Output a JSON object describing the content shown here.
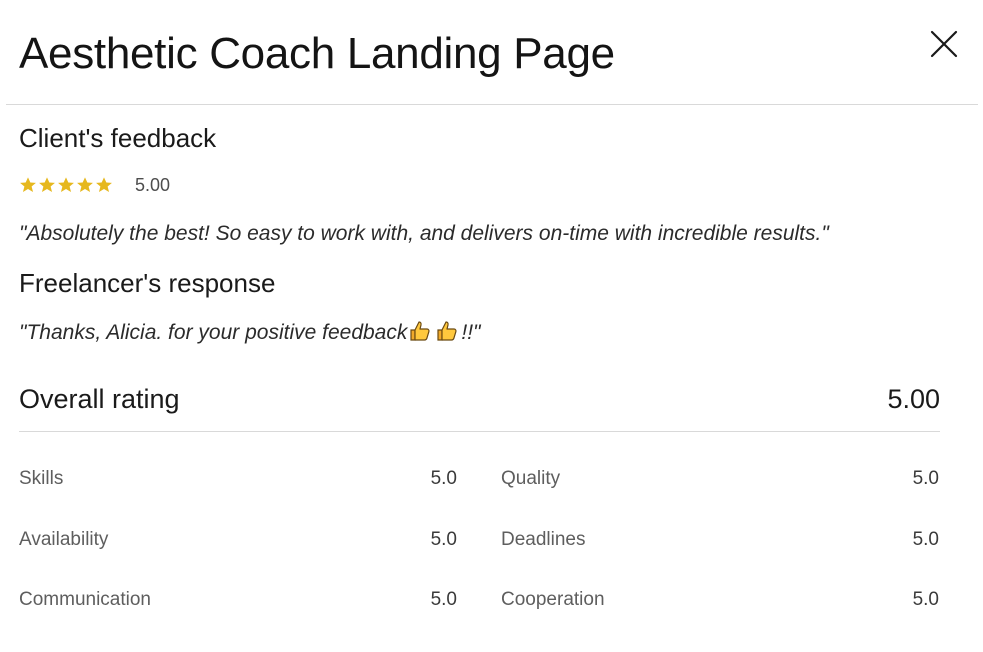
{
  "header": {
    "title": "Aesthetic Coach Landing Page",
    "close_icon": "close-icon"
  },
  "client_feedback": {
    "heading": "Client's feedback",
    "star_count": 5,
    "star_color": "#e6b81e",
    "score": "5.00",
    "quote": "\"Absolutely the best! So easy to work with, and delivers on-time with incredible results.\""
  },
  "freelancer_response": {
    "heading": "Freelancer's response",
    "quote_text": "\"Thanks, Alicia. for your positive feedback",
    "quote_end": "!!\"",
    "emoji": [
      "thumbs-up-icon",
      "thumbs-up-icon"
    ]
  },
  "overall": {
    "label": "Overall rating",
    "value": "5.00"
  },
  "metrics": [
    {
      "label": "Skills",
      "value": "5.0"
    },
    {
      "label": "Quality",
      "value": "5.0"
    },
    {
      "label": "Availability",
      "value": "5.0"
    },
    {
      "label": "Deadlines",
      "value": "5.0"
    },
    {
      "label": "Communication",
      "value": "5.0"
    },
    {
      "label": "Cooperation",
      "value": "5.0"
    }
  ]
}
